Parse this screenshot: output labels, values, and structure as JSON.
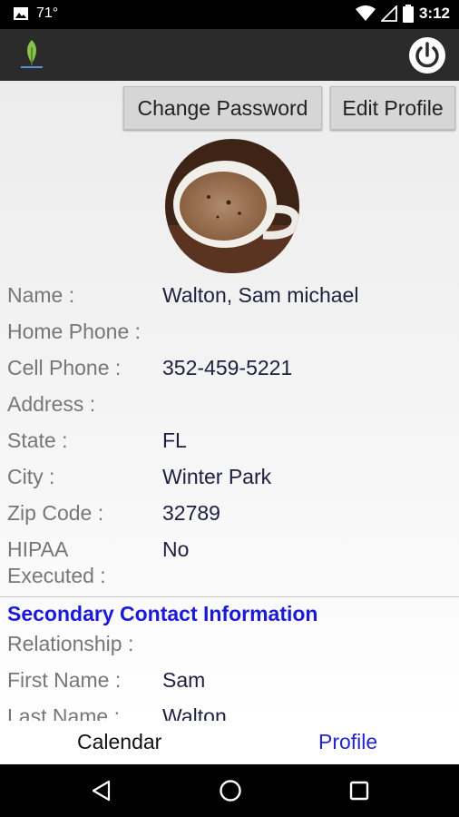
{
  "status": {
    "temperature": "71°",
    "time": "3:12"
  },
  "buttons": {
    "change_password": "Change Password",
    "edit_profile": "Edit Profile"
  },
  "profile": {
    "fields": [
      {
        "label": "Name :",
        "value": "Walton, Sam michael"
      },
      {
        "label": "Home Phone :",
        "value": ""
      },
      {
        "label": "Cell Phone :",
        "value": "352-459-5221"
      },
      {
        "label": "Address :",
        "value": ""
      },
      {
        "label": "State :",
        "value": "FL"
      },
      {
        "label": "City :",
        "value": "Winter Park"
      },
      {
        "label": "Zip Code :",
        "value": "32789"
      },
      {
        "label_line1": "HIPAA",
        "label_line2": "Executed :",
        "value": "No"
      }
    ]
  },
  "secondary": {
    "title": "Secondary Contact Information",
    "fields": [
      {
        "label": "Relationship :",
        "value": ""
      },
      {
        "label": "First Name :",
        "value": "Sam"
      },
      {
        "label": "Last Name :",
        "value": "Walton"
      }
    ]
  },
  "tabs": {
    "calendar": "Calendar",
    "profile": "Profile"
  },
  "colors": {
    "appbar": "#2b2b2b",
    "section_title": "#1b1bd6",
    "active_tab": "#2323d6",
    "value_text": "#1d2040",
    "label_text": "#777777"
  }
}
